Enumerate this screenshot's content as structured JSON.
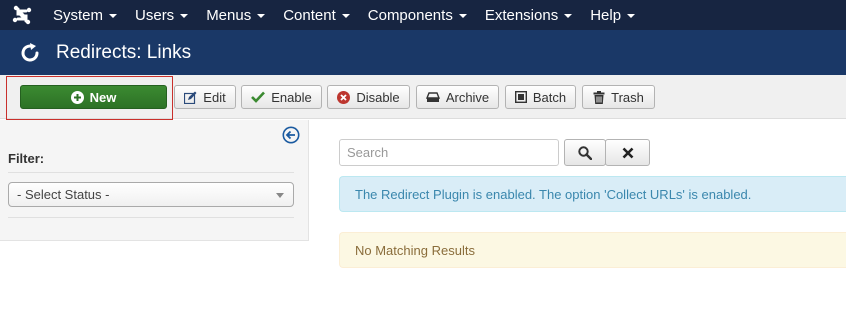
{
  "navbar": {
    "logo_icon": "joomla-logo-icon",
    "items": [
      {
        "label": "System"
      },
      {
        "label": "Users"
      },
      {
        "label": "Menus"
      },
      {
        "label": "Content"
      },
      {
        "label": "Components"
      },
      {
        "label": "Extensions"
      },
      {
        "label": "Help"
      }
    ]
  },
  "header": {
    "title": "Redirects: Links",
    "icon": "redirect-icon"
  },
  "toolbar": {
    "new_label": "New",
    "edit_label": "Edit",
    "enable_label": "Enable",
    "disable_label": "Disable",
    "archive_label": "Archive",
    "batch_label": "Batch",
    "trash_label": "Trash"
  },
  "sidebar": {
    "filter_label": "Filter:",
    "status_select": {
      "selected": "- Select Status -"
    }
  },
  "search": {
    "placeholder": "Search",
    "value": ""
  },
  "alerts": {
    "info": "The Redirect Plugin is enabled. The option 'Collect URLs' is enabled.",
    "no_results": "No Matching Results"
  },
  "colors": {
    "navbar_bg": "#172541",
    "titlebar_bg": "#1a3867",
    "new_button": "#2d7226",
    "highlight_border": "#c9302c",
    "info_bg": "#d9edf7",
    "warning_bg": "#fcf8e3"
  }
}
